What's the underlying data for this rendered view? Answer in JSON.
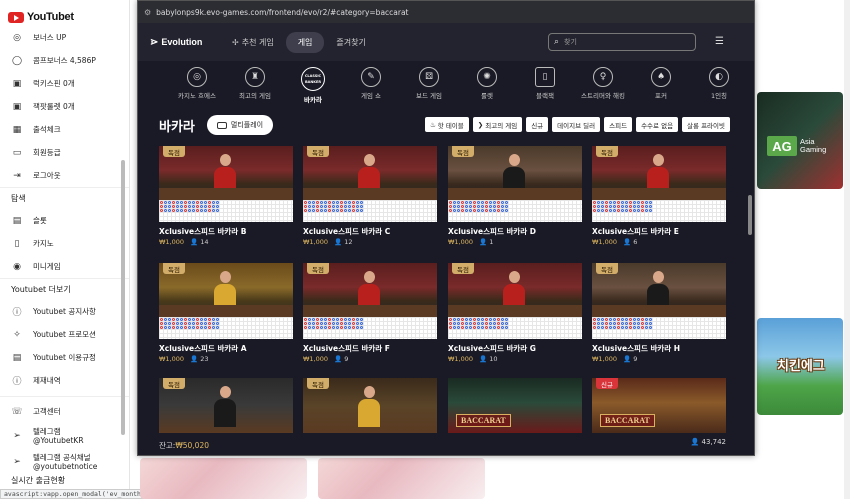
{
  "site": {
    "brand": "YouTubet",
    "colors": {
      "brand_red": "#e02424",
      "popup_bg": "#1a1a26",
      "gold": "#e0b860",
      "badge_gold": "#d2ad6a",
      "badge_new": "#d8343a"
    }
  },
  "sidebar": {
    "items_top": [
      {
        "label": "보너스 UP",
        "icon": "circle-icon"
      },
      {
        "label": "콤프보너스 4,586P",
        "icon": "coin-icon"
      },
      {
        "label": "럭키스핀 0개",
        "icon": "ticket-icon"
      },
      {
        "label": "잭팟룰렛 0개",
        "icon": "ticket-icon"
      },
      {
        "label": "출석체크",
        "icon": "calendar-icon"
      },
      {
        "label": "회원등급",
        "icon": "card-icon"
      },
      {
        "label": "로그아웃",
        "icon": "logout-icon"
      }
    ],
    "section_explore": "탐색",
    "items_explore": [
      {
        "label": "슬롯",
        "icon": "slot-icon"
      },
      {
        "label": "카지노",
        "icon": "cards-icon"
      },
      {
        "label": "미니게임",
        "icon": "target-icon"
      }
    ],
    "section_more": "Youtubet 더보기",
    "items_more": [
      {
        "label": "Youtubet 공지사항",
        "icon": "info-icon"
      },
      {
        "label": "Youtubet 프로모션",
        "icon": "sparkle-icon"
      },
      {
        "label": "Youtubet 이용규정",
        "icon": "document-icon"
      },
      {
        "label": "제재내역",
        "icon": "info-icon"
      }
    ],
    "items_contact": [
      {
        "label": "고객센터",
        "icon": "phone-icon"
      },
      {
        "label_line1": "텔레그램",
        "label_line2": "@YoutubetKR",
        "icon": "telegram-icon"
      },
      {
        "label_line1": "텔레그램 공식채널",
        "label_line2": "@youtubetnotice",
        "icon": "telegram-icon"
      }
    ],
    "bottom_heading": "실시간 출금현황"
  },
  "status_bar": "avascript:vapp.open_modal('ev_month');",
  "promos": {
    "ag_line1": "Asia",
    "ag_line2": "Gaming",
    "ag_mark": "AG",
    "chicken": "치킨에그"
  },
  "popup": {
    "url": "babylonps9k.evo-games.com/frontend/evo/r2/#category=baccarat",
    "logo": "Evolution",
    "nav": {
      "recommended": "추천 게임",
      "games": "게임",
      "favorites": "즐겨찾기"
    },
    "search_placeholder": "찾기",
    "categories": [
      {
        "label": "카지노 흐에스",
        "icon": "chip-icon"
      },
      {
        "label": "최고의 게임",
        "icon": "trophy-icon"
      },
      {
        "label": "바카라",
        "icon": "baccarat-icon",
        "active": true,
        "icon_text_top": "CLASSIC",
        "icon_text_bottom": "BANKER"
      },
      {
        "label": "게임 쇼",
        "icon": "microphone-icon"
      },
      {
        "label": "보드 게임",
        "icon": "dice-icon"
      },
      {
        "label": "룰렛",
        "icon": "roulette-icon"
      },
      {
        "label": "블랙잭",
        "icon": "blackjack-icon"
      },
      {
        "label": "스트리머와 해킹",
        "icon": "streamer-icon"
      },
      {
        "label": "포커",
        "icon": "poker-icon"
      },
      {
        "label": "1인칭",
        "icon": "firstperson-icon"
      }
    ],
    "page_title": "바카라",
    "multi_play": "멀티플레이",
    "filters": [
      {
        "label": "핫 테이블",
        "icon": "fire-icon"
      },
      {
        "label": "최고의 게임",
        "icon": "tag-icon"
      },
      {
        "label": "신규"
      },
      {
        "label": "데이지브 딜러"
      },
      {
        "label": "스피드"
      },
      {
        "label": "수수료 없음"
      },
      {
        "label": "살롱 프라이빗"
      }
    ],
    "games": [
      {
        "badge": "독점",
        "name": "Xclusive스피드 바카라 B",
        "bet": "₩1,000",
        "players": "14",
        "dealer": "red"
      },
      {
        "badge": "독점",
        "name": "Xclusive스피드 바카라 C",
        "bet": "₩1,000",
        "players": "12",
        "dealer": "red"
      },
      {
        "badge": "독점",
        "name": "Xclusive스피드 바카라 D",
        "bet": "₩1,000",
        "players": "1",
        "dealer": "dark"
      },
      {
        "badge": "독점",
        "name": "Xclusive스피드 바카라 E",
        "bet": "₩1,000",
        "players": "6",
        "dealer": "red"
      },
      {
        "badge": "독점",
        "name": "Xclusive스피드 바카라 A",
        "bet": "₩1,000",
        "players": "23",
        "dealer": "gold"
      },
      {
        "badge": "독점",
        "name": "Xclusive스피드 바카라 F",
        "bet": "₩1,000",
        "players": "9",
        "dealer": "red"
      },
      {
        "badge": "독점",
        "name": "Xclusive스피드 바카라 G",
        "bet": "₩1,000",
        "players": "10",
        "dealer": "red"
      },
      {
        "badge": "독점",
        "name": "Xclusive스피드 바카라 H",
        "bet": "₩1,000",
        "players": "9",
        "dealer": "dark"
      }
    ],
    "bottom_row": [
      {
        "badge": "독점"
      },
      {
        "badge": "독점"
      },
      {
        "logo": "BACCARAT"
      },
      {
        "badge": "신규",
        "logo": "BACCARAT"
      }
    ],
    "balance_label": "잔고: ",
    "balance_value": "₩50,020",
    "total_players": "43,742"
  }
}
